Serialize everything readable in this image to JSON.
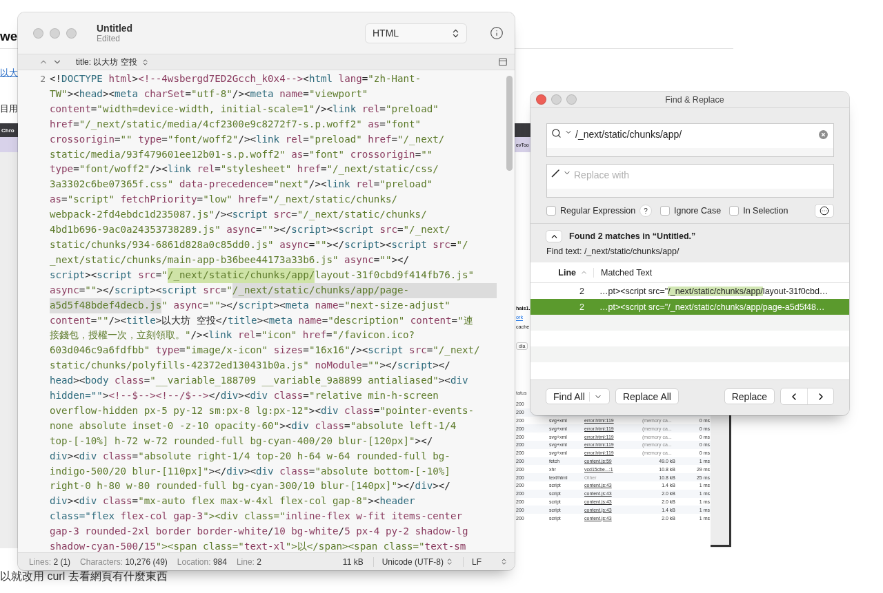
{
  "page": {
    "heading": "we",
    "link": "以大",
    "line": "目用",
    "screenshot": {
      "browser_label": "Chro",
      "devtools_label": "evToo",
      "host": "hals1.",
      "tab": "ork",
      "option": "cache",
      "filter": "dia",
      "status_header": "tatus",
      "rows": [
        {
          "status": "200"
        },
        {
          "status": "200"
        },
        {
          "status": "200",
          "type": "svg+xml",
          "initiator": "error.html:119",
          "link": true,
          "size": "(memory ca...",
          "time": "0 ms"
        },
        {
          "status": "200",
          "type": "svg+xml",
          "initiator": "error.html:119",
          "link": true,
          "size": "(memory ca...",
          "time": "0 ms"
        },
        {
          "status": "200",
          "type": "svg+xml",
          "initiator": "error.html:119",
          "link": true,
          "size": "(memory ca...",
          "time": "0 ms"
        },
        {
          "status": "200",
          "type": "svg+xml",
          "initiator": "error.html:119",
          "link": true,
          "size": "(memory ca...",
          "time": "0 ms"
        },
        {
          "status": "200",
          "type": "svg+xml",
          "initiator": "error.html:119",
          "link": true,
          "size": "(memory ca...",
          "time": "0 ms"
        },
        {
          "status": "200",
          "type": "fetch",
          "initiator": "content.js:59",
          "link": true,
          "size": "49.0 kB",
          "time": "1 ms"
        },
        {
          "status": "200",
          "type": "xhr",
          "initiator": "vcd15cbe...:1",
          "link": true,
          "size": "10.8 kB",
          "time": "29 ms"
        },
        {
          "status": "200",
          "type": "text/html",
          "initiator": "Other",
          "link": false,
          "size": "10.8 kB",
          "time": "25 ms"
        },
        {
          "status": "200",
          "type": "script",
          "initiator": "content.js:43",
          "link": true,
          "size": "1.4 kB",
          "time": "1 ms"
        },
        {
          "status": "200",
          "type": "script",
          "initiator": "content.js:43",
          "link": true,
          "size": "2.0 kB",
          "time": "1 ms"
        },
        {
          "status": "200",
          "type": "script",
          "initiator": "content.js:43",
          "link": true,
          "size": "2.0 kB",
          "time": "1 ms"
        },
        {
          "status": "200",
          "type": "script",
          "initiator": "content.js:43",
          "link": true,
          "size": "1.4 kB",
          "time": "1 ms"
        },
        {
          "status": "200",
          "type": "script",
          "initiator": "content.js:43",
          "link": true,
          "size": "2.0 kB",
          "time": "1 ms"
        }
      ]
    },
    "caption": "以就改用 curl 去看網頁有什麼東西"
  },
  "editor": {
    "title": "Untitled",
    "subtitle": "Edited",
    "syntax": "HTML",
    "jump": "title: 以大坊 空投",
    "line_number": "2",
    "lines": [
      {
        "parts": [
          {
            "text": "<!DOCTYPE html><!--4wsbergd7ED2Gcch_k0x4--><html lang=\"zh-Hant-"
          }
        ]
      },
      {
        "parts": [
          {
            "text": "TW\"><head><meta charSet=\"utf-8\"/><meta name=\"viewport\""
          }
        ]
      },
      {
        "parts": [
          {
            "text": "content=\"width=device-width, initial-scale=1\"/><link rel=\"preload\""
          }
        ]
      },
      {
        "parts": [
          {
            "text": "href=\"/_next/static/media/4cf2300e9c8272f7-s.p.woff2\" as=\"font\""
          }
        ]
      },
      {
        "parts": [
          {
            "text": "crossorigin=\"\" type=\"font/woff2\"/><link rel=\"preload\" href=\"/_next/"
          }
        ]
      },
      {
        "parts": [
          {
            "text": "static/media/93f479601ee12b01-s.p.woff2\" as=\"font\" crossorigin=\"\""
          }
        ]
      },
      {
        "parts": [
          {
            "text": "type=\"font/woff2\"/><link rel=\"stylesheet\" href=\"/_next/static/css/"
          }
        ]
      },
      {
        "parts": [
          {
            "text": "3a3302c6be07365f.css\" data-precedence=\"next\"/><link rel=\"preload\""
          }
        ]
      },
      {
        "parts": [
          {
            "text": "as=\"script\" fetchPriority=\"low\" href=\"/_next/static/chunks/"
          }
        ]
      },
      {
        "parts": [
          {
            "text": "webpack-2fd4ebdc1d235087.js\"/><script src=\"/_next/static/chunks/"
          }
        ]
      },
      {
        "parts": [
          {
            "text": "4bd1b696-9ac0a24353738289.js\" async=\"\"></script><script src=\"/_next/"
          }
        ]
      },
      {
        "parts": [
          {
            "text": "static/chunks/934-6861d828a0c85dd0.js\" async=\"\"></script><script src=\"/"
          }
        ]
      },
      {
        "parts": [
          {
            "text": "_next/static/chunks/main-app-b36bee44173a33b6.js\" async=\"\"></"
          }
        ]
      },
      {
        "parts": [
          {
            "text": "script><script src=\""
          },
          {
            "text": "/_next/static/chunks/app/",
            "highlighted": true
          },
          {
            "text": "layout-31f0cbd9f414fb76.js\""
          }
        ]
      },
      {
        "parts": [
          {
            "text": "async=\"\"></script><script src=\""
          },
          {
            "text": "/_next/static/chunks/app/page-",
            "selected": true
          }
        ]
      },
      {
        "parts": [
          {
            "text": "a5d5f48bdef4decb.js",
            "selected": true
          },
          {
            "text": "\" async=\"\"></script><meta name=\"next-size-adjust\""
          }
        ]
      },
      {
        "parts": [
          {
            "text": "content=\"\"/><title>以大坊 空投</title><meta name=\"description\" content=\"連"
          }
        ]
      },
      {
        "parts": [
          {
            "text": "接錢包，授權一次，立刻領取。\"/><link rel=\"icon\" href=\"/favicon.ico?"
          }
        ]
      },
      {
        "parts": [
          {
            "text": "603d046c9a6fdfbb\" type=\"image/x-icon\" sizes=\"16x16\"/><script src=\"/_next/"
          }
        ]
      },
      {
        "parts": [
          {
            "text": "static/chunks/polyfills-42372ed130431b0a.js\" noModule=\"\"></script></"
          }
        ]
      },
      {
        "parts": [
          {
            "text": "head><body class=\"__variable_188709 __variable_9a8899 antialiased\"><div"
          }
        ]
      },
      {
        "parts": [
          {
            "text": "hidden=\"\"><!--$--><!--/$--></div><div class=\"relative min-h-screen"
          }
        ]
      },
      {
        "parts": [
          {
            "text": "overflow-hidden px-5 py-12 sm:px-8 lg:px-12\"><div class=\"pointer-events-"
          }
        ]
      },
      {
        "parts": [
          {
            "text": "none absolute inset-0 -z-10 opacity-60\"><div class=\"absolute left-1/4"
          }
        ]
      },
      {
        "parts": [
          {
            "text": "top-[-10%] h-72 w-72 rounded-full bg-cyan-400/20 blur-[120px]\"></"
          }
        ]
      },
      {
        "parts": [
          {
            "text": "div><div class=\"absolute right-1/4 top-20 h-64 w-64 rounded-full bg-"
          }
        ]
      },
      {
        "parts": [
          {
            "text": "indigo-500/20 blur-[110px]\"></div><div class=\"absolute bottom-[-10%]"
          }
        ]
      },
      {
        "parts": [
          {
            "text": "right-0 h-80 w-80 rounded-full bg-cyan-300/10 blur-[140px]\"></div></"
          }
        ]
      },
      {
        "parts": [
          {
            "text": "div><div class=\"mx-auto flex max-w-4xl flex-col gap-8\"><header"
          }
        ]
      },
      {
        "parts": [
          {
            "text": "class=\"flex flex-col gap-3\"><div class=\"inline-flex w-fit items-center"
          }
        ]
      },
      {
        "parts": [
          {
            "text": "gap-3 rounded-2xl border border-white/10 bg-white/5 px-4 py-2 shadow-lg"
          }
        ]
      },
      {
        "parts": [
          {
            "text": "shadow-cyan-500/15\"><span class=\"text-xl\">以</span><span class=\"text-sm"
          }
        ]
      }
    ],
    "status": {
      "items": [
        {
          "label": "Lines:",
          "value": "2 (1)"
        },
        {
          "label": "Characters:",
          "value": "10,276 (49)"
        },
        {
          "label": "Location:",
          "value": "984"
        },
        {
          "label": "Line:",
          "value": "2"
        }
      ],
      "size": "11 kB",
      "encoding": "Unicode (UTF-8)",
      "line_ending": "LF"
    }
  },
  "find": {
    "title": "Find & Replace",
    "query": "/_next/static/chunks/app/",
    "replace_placeholder": "Replace with",
    "options": [
      {
        "label": "Regular Expression",
        "checked": false,
        "help": "?"
      },
      {
        "label": "Ignore Case",
        "checked": false
      },
      {
        "label": "In Selection",
        "checked": false
      }
    ],
    "summary": "Found 2 matches in “Untitled.”",
    "find_text": "Find text: /_next/static/chunks/app/",
    "columns": [
      "Line",
      "Matched Text"
    ],
    "results": [
      {
        "line": "2",
        "before": "…pt><script src=\"",
        "match": "/_next/static/chunks/app/",
        "after": "layout-31f0cbd…",
        "selected": false
      },
      {
        "line": "2",
        "before": "…pt><script src=\"",
        "match": "/_next/static/chunks/app/",
        "after": "page-a5d5f48…",
        "selected": true
      }
    ],
    "buttons": {
      "find_all": "Find All",
      "replace_all": "Replace All",
      "replace": "Replace"
    }
  }
}
